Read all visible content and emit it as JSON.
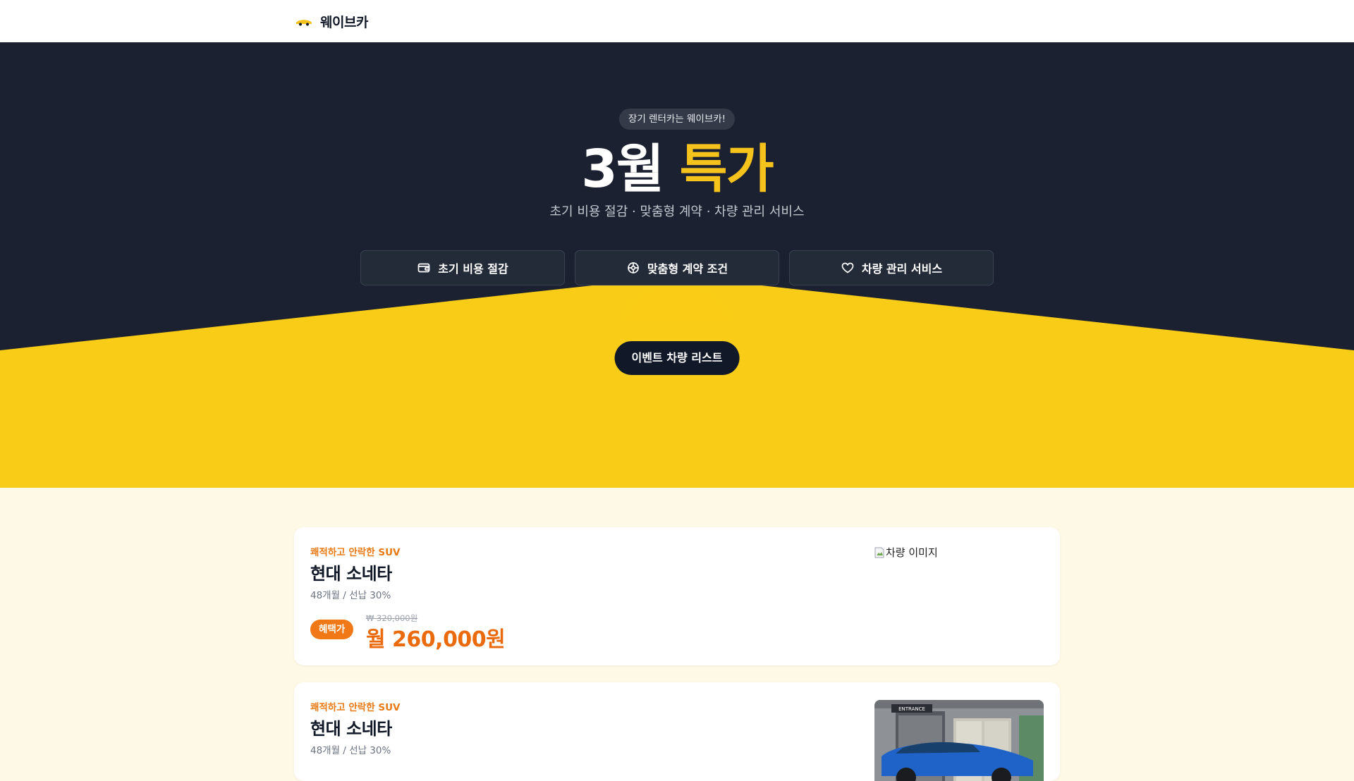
{
  "brand": {
    "name": "웨이브카",
    "colors": {
      "accent": "#f6c21c",
      "dark": "#1b2130",
      "orange": "#ea6a0c"
    }
  },
  "hero": {
    "pill": "장기 렌터카는 웨이브카!",
    "title_main": "3월",
    "title_accent": "특가",
    "subtitle": "초기 비용 절감 · 맞춤형 계약 · 차량 관리 서비스",
    "features": [
      {
        "label": "초기 비용 절감",
        "icon": "wallet-icon"
      },
      {
        "label": "맞춤형 계약 조건",
        "icon": "settings-icon"
      },
      {
        "label": "차량 관리 서비스",
        "icon": "heart-icon"
      }
    ],
    "cta_label": "이벤트 차량 리스트"
  },
  "cars": [
    {
      "tagline": "쾌적하고 안락한 SUV",
      "name": "현대 소네타",
      "terms": "48개월 / 선납 30%",
      "badge": "혜택가",
      "old_price": "₩ 320,000원",
      "price": "월 260,000원",
      "image_alt": "차량 이미지"
    },
    {
      "tagline": "쾌적하고 안락한 SUV",
      "name": "현대 소네타",
      "terms": "48개월 / 선납 30%",
      "image_sign": "ENTRANCE"
    }
  ]
}
